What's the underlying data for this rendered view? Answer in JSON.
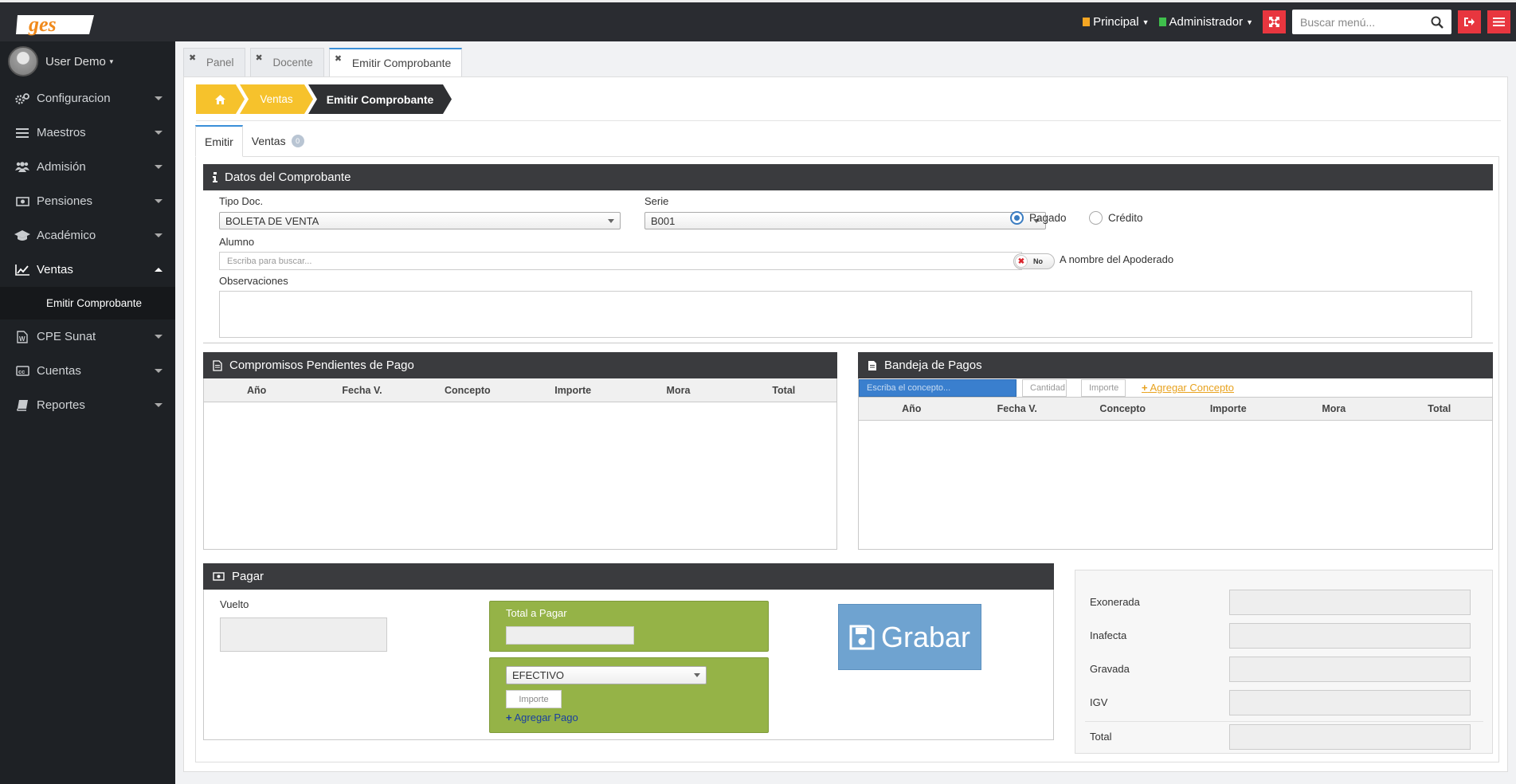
{
  "header": {
    "logo_text": "ges",
    "principal": "Principal",
    "admin": "Administrador",
    "search_placeholder": "Buscar menú..."
  },
  "sidebar": {
    "user": "User Demo",
    "items": [
      {
        "label": "Configuracion",
        "icon": "gears-icon"
      },
      {
        "label": "Maestros",
        "icon": "list-icon"
      },
      {
        "label": "Admisión",
        "icon": "users-icon"
      },
      {
        "label": "Pensiones",
        "icon": "money-icon"
      },
      {
        "label": "Académico",
        "icon": "graduation-cap-icon"
      },
      {
        "label": "Ventas",
        "icon": "line-chart-icon"
      },
      {
        "label": "CPE Sunat",
        "icon": "file-word-icon"
      },
      {
        "label": "Cuentas",
        "icon": "cc-icon"
      },
      {
        "label": "Reportes",
        "icon": "book-icon"
      }
    ],
    "submenu": "Emitir Comprobante"
  },
  "tabs": [
    "Panel",
    "Docente",
    "Emitir Comprobante"
  ],
  "breadcrumb": {
    "second": "Ventas",
    "current": "Emitir Comprobante"
  },
  "inner_tabs": {
    "emitir": "Emitir",
    "ventas": "Ventas",
    "ventas_count": "0"
  },
  "datos": {
    "title": "Datos del Comprobante",
    "tipo_doc_label": "Tipo Doc.",
    "tipo_doc_value": "BOLETA DE VENTA",
    "serie_label": "Serie",
    "serie_value": "B001",
    "pagado": "Pagado",
    "credito": "Crédito",
    "alumno_label": "Alumno",
    "alumno_placeholder": "Escriba para buscar...",
    "toggle_text": "No",
    "apoderado_label": "A nombre del Apoderado",
    "observaciones_label": "Observaciones"
  },
  "compromisos": {
    "title": "Compromisos Pendientes de Pago",
    "columns": [
      "Año",
      "Fecha V.",
      "Concepto",
      "Importe",
      "Mora",
      "Total"
    ]
  },
  "bandeja": {
    "title": "Bandeja de Pagos",
    "concepto_placeholder": "Escriba el concepto...",
    "cantidad_placeholder": "Cantidad",
    "importe_placeholder": "Importe",
    "agregar_concepto": "Agregar Concepto",
    "columns": [
      "Año",
      "Fecha V.",
      "Concepto",
      "Importe",
      "Mora",
      "Total"
    ]
  },
  "pagar": {
    "title": "Pagar",
    "vuelto_label": "Vuelto",
    "total_label": "Total a Pagar",
    "metodo_value": "EFECTIVO",
    "importe_placeholder": "Importe",
    "agregar_pago": "Agregar Pago",
    "grabar": "Grabar"
  },
  "totales": {
    "exonerada": "Exonerada",
    "inafecta": "Inafecta",
    "gravada": "Gravada",
    "igv": "IGV",
    "total": "Total"
  },
  "colors": {
    "accent_yellow": "#f6c22c",
    "dark": "#2a2c31",
    "red": "#e8363f",
    "green": "#95b347",
    "grabar": "#6fa3d0"
  }
}
